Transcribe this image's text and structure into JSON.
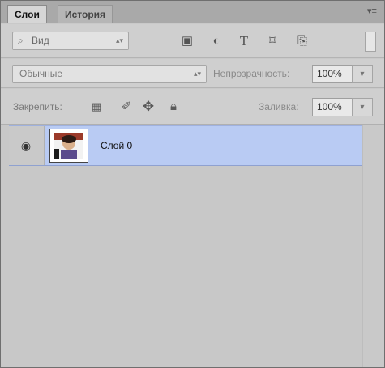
{
  "tabs": [
    {
      "label": "Слои",
      "active": true
    },
    {
      "label": "История",
      "active": false
    }
  ],
  "filter": {
    "kind_label": "Вид",
    "icons": [
      "image-filter-icon",
      "adjustment-filter-icon",
      "type-filter-icon",
      "shape-filter-icon",
      "smart-object-filter-icon"
    ]
  },
  "blend": {
    "mode": "Обычные",
    "opacity_label": "Непрозрачность:",
    "opacity_value": "100%"
  },
  "lock": {
    "label": "Закрепить:",
    "fill_label": "Заливка:",
    "fill_value": "100%"
  },
  "layers": [
    {
      "name": "Слой 0",
      "visible": true,
      "selected": true
    }
  ],
  "colors": {
    "panel_bg": "#c9c9c9",
    "selected_layer": "#b9cbf3",
    "tab_bar": "#a9a9a9"
  }
}
